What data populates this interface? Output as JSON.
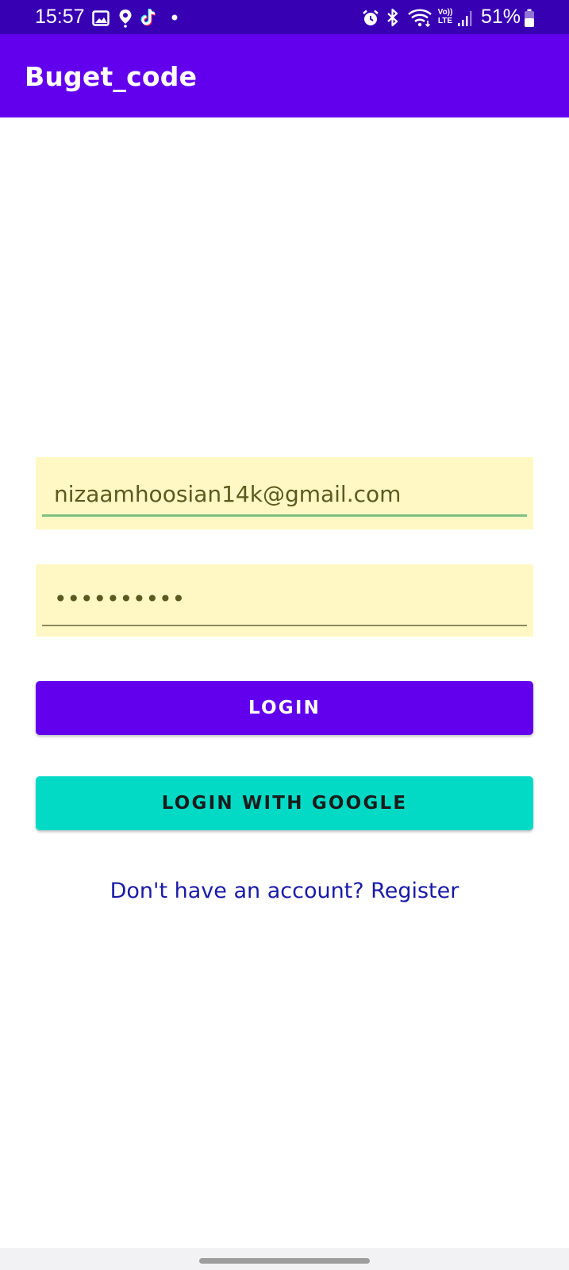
{
  "status_bar": {
    "time": "15:57",
    "battery": "51%",
    "icons": [
      "gallery-icon",
      "location-pin-icon",
      "tiktok-icon",
      "notification-dot-icon",
      "alarm-icon",
      "bluetooth-icon",
      "wifi-icon",
      "volte-icon",
      "signal-icon",
      "battery-icon"
    ],
    "volte_label": "Vo)) LTE"
  },
  "app_bar": {
    "title": "Buget_code"
  },
  "form": {
    "email_value": "nizaamhoosian14k@gmail.com",
    "password_value": "••••••••••"
  },
  "buttons": {
    "login_label": "LOGIN",
    "google_label": "LOGIN WITH GOOGLE"
  },
  "register_link": "Don't have an account? Register",
  "colors": {
    "status_bar": "#3700b3",
    "primary": "#6200ee",
    "secondary": "#03dac5",
    "field_background": "#fff8c4",
    "link": "#1a1aa8"
  }
}
